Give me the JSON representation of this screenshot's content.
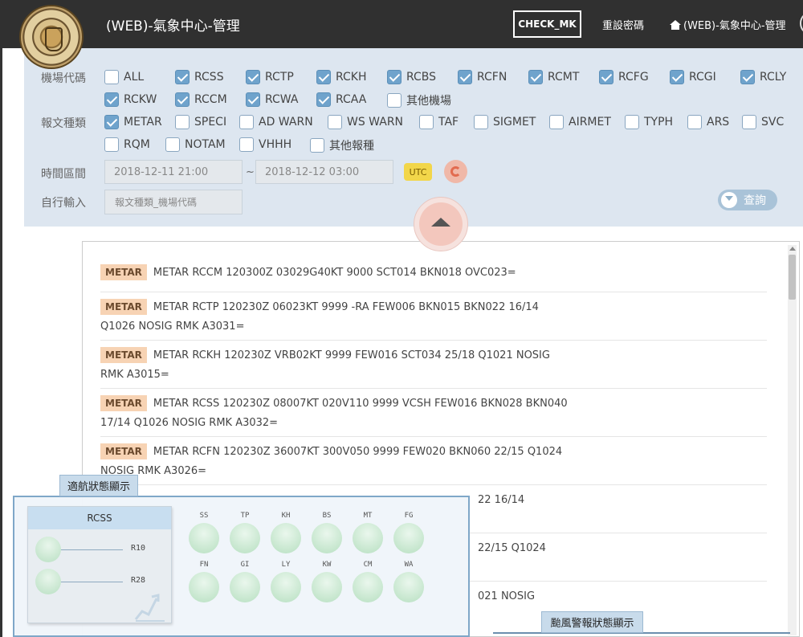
{
  "header": {
    "app_title": "(WEB)-氣象中心-管理",
    "check_button": "CHECK_MK",
    "reset_password": "重設密碼",
    "home_link": "(WEB)-氣象中心-管理"
  },
  "filters": {
    "airport_label": "機場代碼",
    "airports": [
      {
        "label": "ALL",
        "checked": false
      },
      {
        "label": "RCSS",
        "checked": true
      },
      {
        "label": "RCTP",
        "checked": true
      },
      {
        "label": "RCKH",
        "checked": true
      },
      {
        "label": "RCBS",
        "checked": true
      },
      {
        "label": "RCFN",
        "checked": true
      },
      {
        "label": "RCMT",
        "checked": true
      },
      {
        "label": "RCFG",
        "checked": true
      },
      {
        "label": "RCGI",
        "checked": true
      },
      {
        "label": "RCLY",
        "checked": true
      },
      {
        "label": "RCKW",
        "checked": true
      },
      {
        "label": "RCCM",
        "checked": true
      },
      {
        "label": "RCWA",
        "checked": true
      },
      {
        "label": "RCAA",
        "checked": true
      },
      {
        "label": "其他機場",
        "checked": false
      }
    ],
    "report_label": "報文種類",
    "reports": [
      {
        "label": "METAR",
        "checked": true
      },
      {
        "label": "SPECI",
        "checked": false
      },
      {
        "label": "AD WARN",
        "checked": false
      },
      {
        "label": "WS WARN",
        "checked": false
      },
      {
        "label": "TAF",
        "checked": false
      },
      {
        "label": "SIGMET",
        "checked": false
      },
      {
        "label": "AIRMET",
        "checked": false
      },
      {
        "label": "TYPH",
        "checked": false
      },
      {
        "label": "ARS",
        "checked": false
      },
      {
        "label": "SVC",
        "checked": false
      },
      {
        "label": "RQM",
        "checked": false
      },
      {
        "label": "NOTAM",
        "checked": false
      },
      {
        "label": "VHHH",
        "checked": false
      },
      {
        "label": "其他報種",
        "checked": false
      }
    ],
    "time_label": "時間區間",
    "time_start": "2018-12-11 21:00",
    "time_sep": "~",
    "time_end": "2018-12-12 03:00",
    "utc_button": "UTC",
    "custom_label": "自行輸入",
    "custom_placeholder": "報文種類_機場代碼",
    "query_button": "查詢"
  },
  "messages": [
    {
      "tag": "METAR",
      "line1": "METAR RCCM 120300Z 03029G40KT 9000 SCT014 BKN018 OVC023=",
      "line2": ""
    },
    {
      "tag": "METAR",
      "line1": "METAR RCTP 120230Z 06023KT 9999 -RA FEW006 BKN015 BKN022 16/14",
      "line2": "Q1026 NOSIG RMK A3031="
    },
    {
      "tag": "METAR",
      "line1": "METAR RCKH 120230Z VRB02KT 9999 FEW016 SCT034 25/18 Q1021 NOSIG",
      "line2": "RMK A3015="
    },
    {
      "tag": "METAR",
      "line1": "METAR RCSS 120230Z 08007KT 020V110 9999 VCSH FEW016 BKN028 BKN040",
      "line2": "17/14 Q1026 NOSIG RMK A3032="
    },
    {
      "tag": "METAR",
      "line1": "METAR RCFN 120230Z 36007KT 300V050 9999 FEW020 BKN060 22/15 Q1024",
      "line2": "NOSIG RMK A3026="
    },
    {
      "tag": "",
      "line1": "22 16/14",
      "line2": ""
    },
    {
      "tag": "",
      "line1": "22/15 Q1024",
      "line2": ""
    },
    {
      "tag": "",
      "line1": "021 NOSIG",
      "line2": ""
    }
  ],
  "status": {
    "tab_label": "適航狀態顯示",
    "runway": {
      "station": "RCSS",
      "runways": [
        "R10",
        "R28"
      ]
    },
    "stations": [
      "SS",
      "TP",
      "KH",
      "BS",
      "MT",
      "FG",
      "FN",
      "GI",
      "LY",
      "KW",
      "CM",
      "WA"
    ],
    "status_color": "#b6dfc0",
    "typhoon_tab": "颱風警報狀態顯示"
  },
  "colors": {
    "topbar": "#303030",
    "panel": "#dde6f0",
    "checkbox_on": "#6fa3cc",
    "tag": "#f7d3b4",
    "utc": "#f2d64a",
    "refresh": "#e26b4f"
  }
}
